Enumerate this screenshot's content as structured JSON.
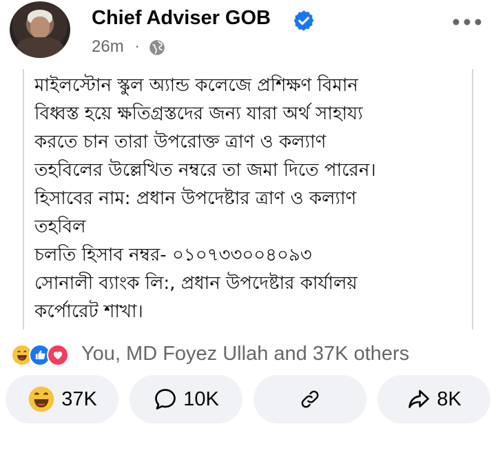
{
  "post": {
    "author": "Chief Adviser GOB",
    "time": "26m",
    "separator": "·",
    "privacy_icon": "globe-icon",
    "verified_icon": "verified-badge-icon",
    "more_icon": "more-horizontal-icon",
    "body_lines": [
      "মাইলস্টোন স্কুল অ্যান্ড কলেজে প্রশিক্ষণ বিমান",
      "বিধ্বস্ত হয়ে ক্ষতিগ্রস্তদের জন্য যারা অর্থ সাহায্য",
      "করতে চান তারা উপরোক্ত ত্রাণ ও কল্যাণ",
      "তহবিলের উল্লেখিত নম্বরে তা জমা দিতে পারেন।",
      "হিসাবের নাম: প্রধান উপদেষ্টার ত্রাণ ও কল্যাণ",
      "তহবিল",
      "চলতি হিসাব নম্বর- ০১০৭৩৩০০৪০৯৩",
      "সোনালী ব্যাংক লি:, প্রধান উপদেষ্টার কার্যালয়",
      "কর্পোরেট শাখা।"
    ]
  },
  "reactions": {
    "icons": [
      "haha-icon",
      "like-icon",
      "love-icon"
    ],
    "summary": "You, MD Foyez Ullah and 37K others"
  },
  "actions": {
    "react_count": "37K",
    "comment_count": "10K",
    "share_count": "8K"
  },
  "colors": {
    "verified": "#1877f2",
    "meta_gray": "#65676b",
    "pill_bg": "#f0f2f5",
    "like_blue": "#1877f2",
    "love_red": "#f33e58",
    "haha_yellow": "#f7c33a"
  }
}
